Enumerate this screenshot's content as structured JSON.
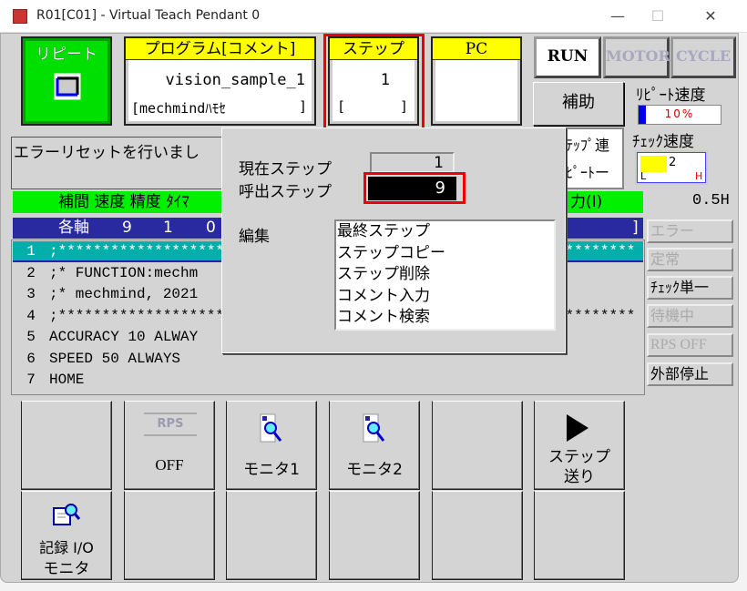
{
  "window": {
    "title": "R01[C01] - Virtual Teach Pendant 0",
    "minimize": "—",
    "maximize": "☐",
    "close": "✕"
  },
  "header": {
    "repeat": {
      "label": "リピート",
      "icon": "repeat-cycle-icon"
    },
    "program": {
      "label": "プログラム[コメント]",
      "name": "vision_sample_1",
      "comment": "[mechmindﾊﾓｾ",
      "comment_end": "]"
    },
    "step": {
      "label": "ステップ",
      "value": "1",
      "comment": "[",
      "comment_end": "]"
    },
    "pc": {
      "label": "PC"
    },
    "run": "RUN",
    "motor": "MOTOR",
    "cycle": "CYCLE",
    "aux": "補助",
    "repeat_speed": {
      "label": "ﾘﾋﾟｰﾄ速度",
      "value": "10%",
      "level_percent": 10
    },
    "check_speed": {
      "label": "ﾁｪｯｸ速度",
      "value": "2",
      "low": "L",
      "high": "H"
    }
  },
  "message": "エラーリセットを行いまし",
  "step_continuous": {
    "line1": "ﾃｯﾌﾟ連",
    "line2": "ﾋﾟｰﾄー"
  },
  "program_table": {
    "header_left": "補間 速度 精度 ﾀｲﾏ",
    "header_right": "力(I)",
    "time": "0.5H",
    "step_row": {
      "interp": "各軸",
      "speed": "9",
      "accuracy": "1",
      "timer": "0",
      "end": "]"
    },
    "lines": [
      {
        "n": "1",
        "text": ";******************************************************************"
      },
      {
        "n": "2",
        "text": ";* FUNCTION:mechm"
      },
      {
        "n": "3",
        "text": ";* mechmind, 2021"
      },
      {
        "n": "4",
        "text": ";******************************************************************"
      },
      {
        "n": "5",
        "text": "ACCURACY 10 ALWAY"
      },
      {
        "n": "6",
        "text": "SPEED 50 ALWAYS"
      },
      {
        "n": "7",
        "text": "HOME"
      }
    ]
  },
  "status": {
    "error": "エラー",
    "steady": "定常",
    "check_single": "ﾁｪｯｸ単一",
    "waiting": "待機中",
    "rps_off": "RPS OFF",
    "ext_stop": "外部停止"
  },
  "dialog": {
    "current_step_label": "現在ステップ",
    "current_step": "1",
    "call_step_label": "呼出ステップ",
    "call_step": "9",
    "edit_label": "編集",
    "edit_items": [
      "最終ステップ",
      "ステップコピー",
      "ステップ削除",
      "コメント入力",
      "コメント検索"
    ]
  },
  "bottom": {
    "rps_icon": "RPS",
    "rps": "OFF",
    "monitor1": "モニタ1",
    "monitor2": "モニタ2",
    "step_forward_1": "ステップ",
    "step_forward_2": "送り",
    "rec_io_1": "記録 I/O",
    "rec_io_2": "モニタ"
  },
  "colors": {
    "green": "#00ff00",
    "yellow": "#ffff00",
    "blue_row": "#2a2aa0",
    "teal_row": "#00b0a8",
    "highlight": "#ff0000"
  }
}
